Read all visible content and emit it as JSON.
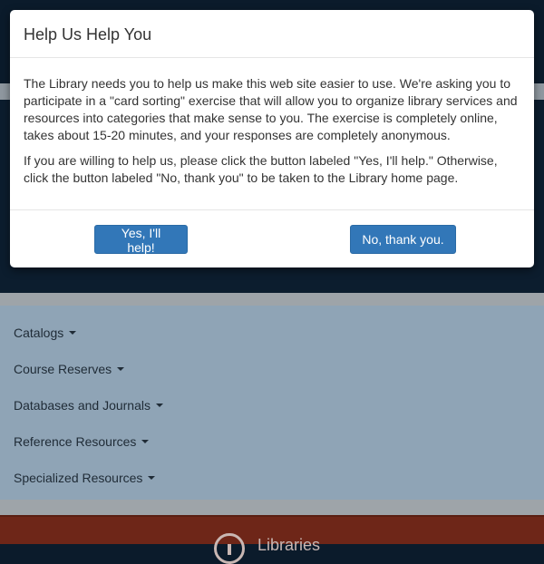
{
  "modal": {
    "title": "Help Us Help You",
    "paragraph1": "The Library needs you to help us make this web site easier to use. We're asking you to participate in a \"card sorting\" exercise that will allow you to organize library services and resources into categories that make sense to you. The exercise is completely online, takes about 15-20 minutes, and your responses are completely anonymous.",
    "paragraph2": "If you are willing to help us, please click the button labeled \"Yes, I'll help.\" Otherwise, click the button labeled \"No, thank you\" to be taken to the Library home page.",
    "yes_label": "Yes, I'll help!",
    "no_label": "No, thank you."
  },
  "nav": {
    "items": [
      {
        "label": "Catalogs"
      },
      {
        "label": "Course Reserves"
      },
      {
        "label": "Databases and Journals"
      },
      {
        "label": "Reference Resources"
      },
      {
        "label": "Specialized Resources"
      }
    ]
  },
  "footer": {
    "label": "Libraries",
    "icon": "power-icon"
  },
  "colors": {
    "primary_button": "#3277b8",
    "footer_bg": "#6e2618",
    "header_bg": "#0c1d2e"
  }
}
